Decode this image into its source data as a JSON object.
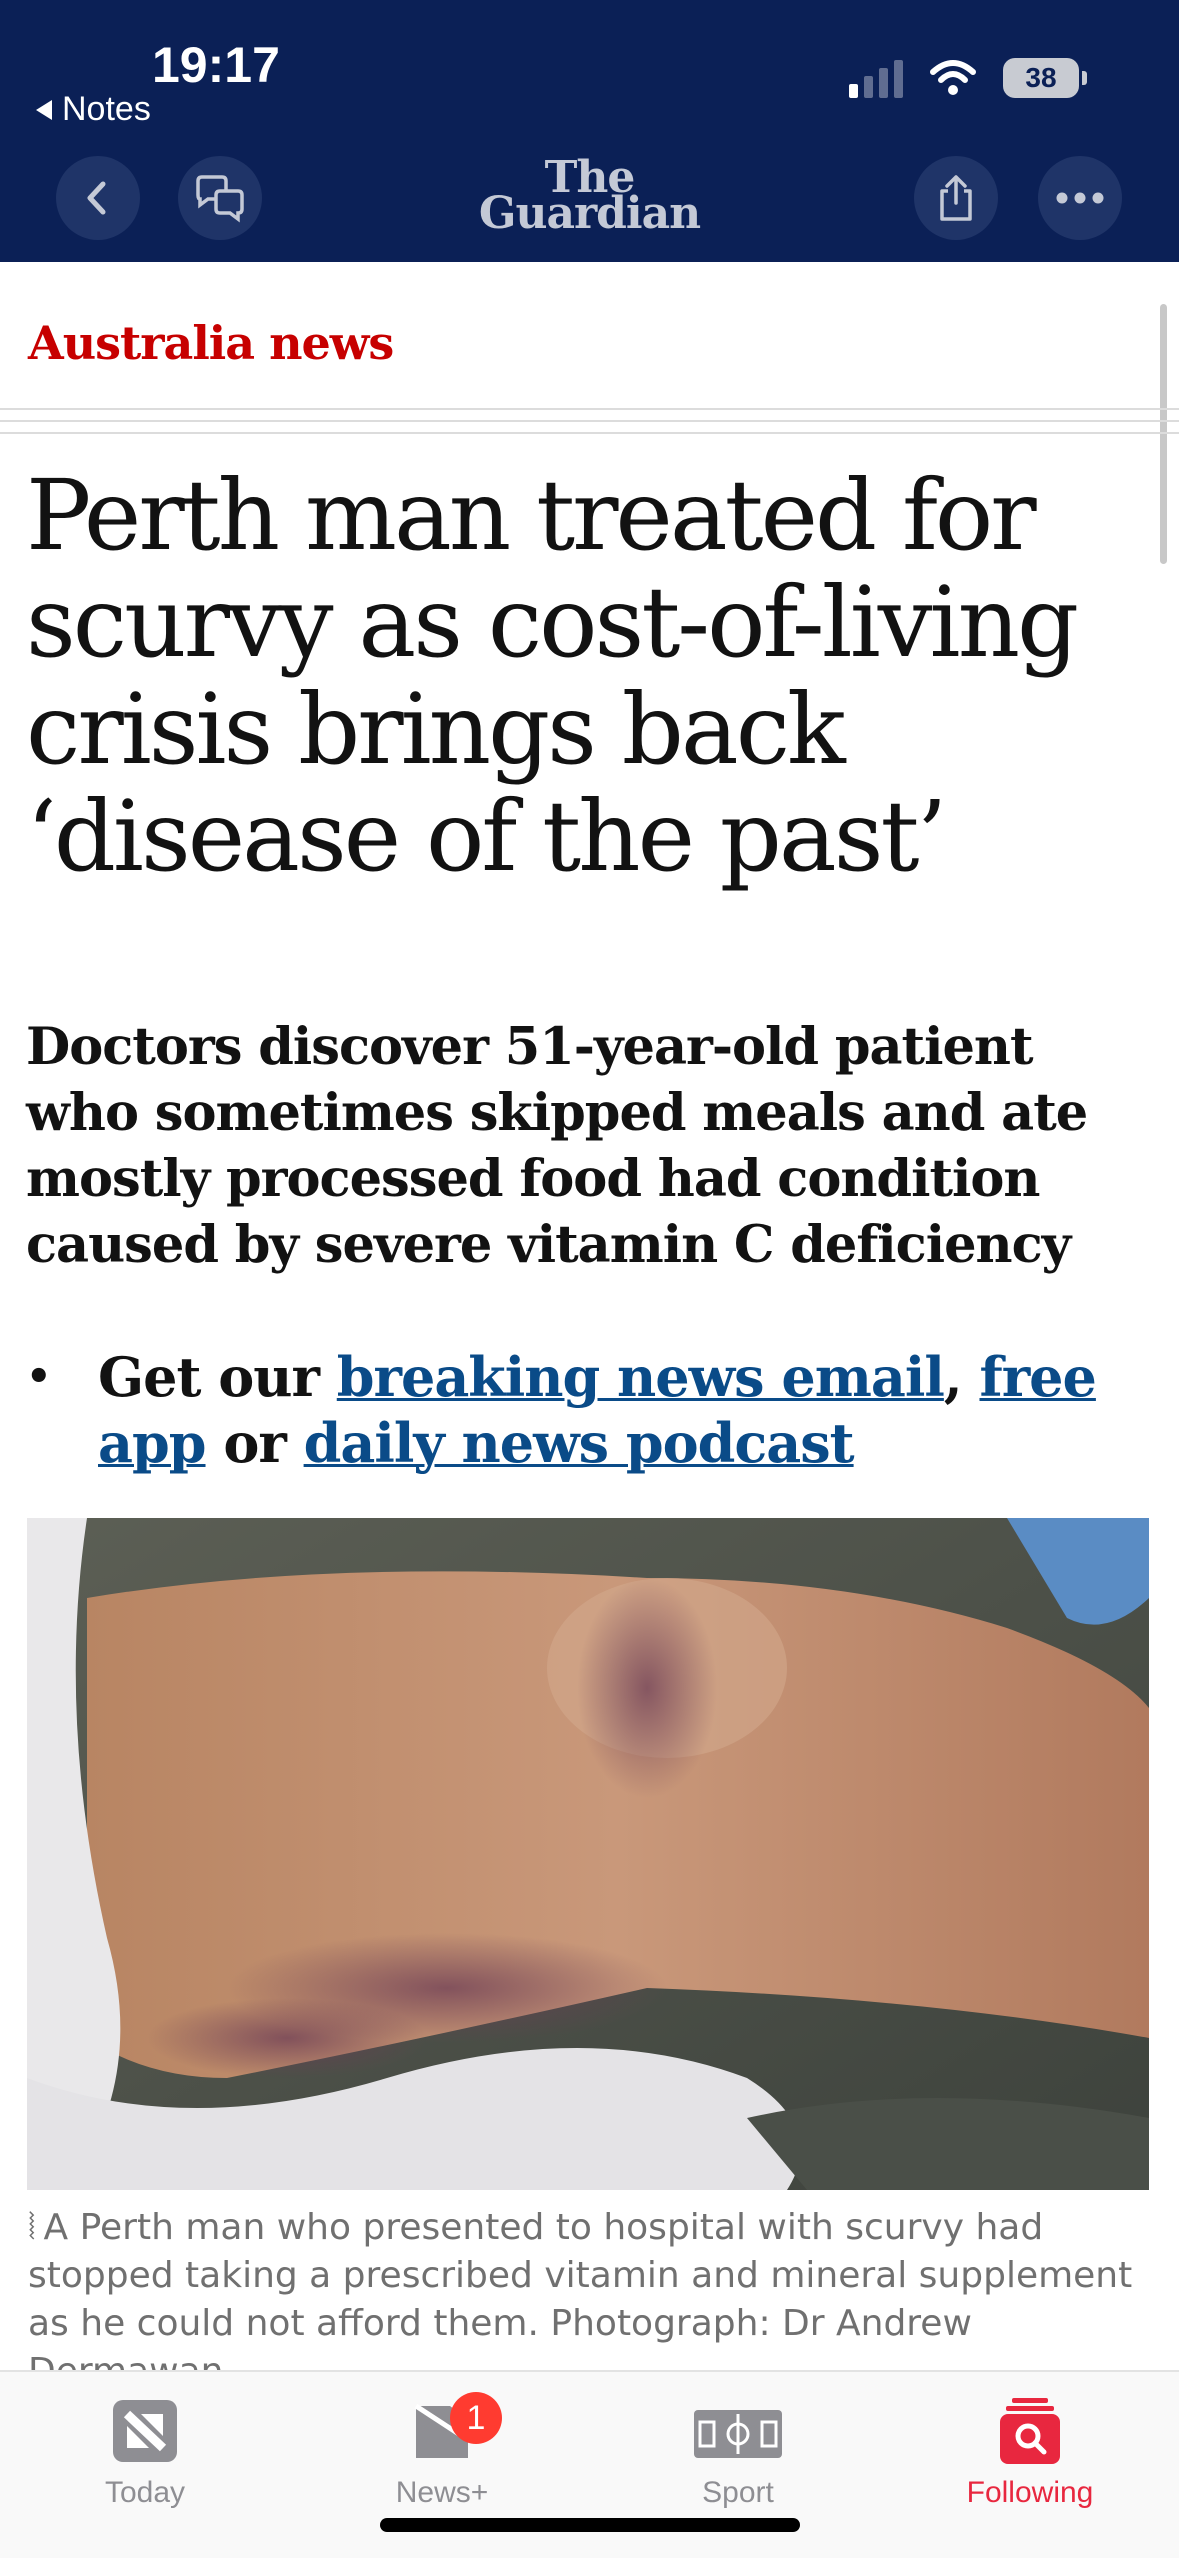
{
  "status_bar": {
    "time": "19:17",
    "back_app": "Notes",
    "battery": "38"
  },
  "header": {
    "brand_line1": "The",
    "brand_line2": "Guardian"
  },
  "article": {
    "section": "Australia news",
    "headline": "Perth man treated for scurvy as cost-of-living crisis brings back ‘disease of the past’",
    "standfirst": "Doctors discover 51-year-old patient who sometimes skipped meals and ate mostly processed food had condition caused by severe vitamin C deficiency",
    "bullet": {
      "prefix": "Get our ",
      "link1": "breaking news email",
      "sep1": ", ",
      "link2": "free app",
      "sep2": " or ",
      "link3": "daily news podcast"
    },
    "image_alt": "Leg with scurvy rash",
    "caption": "A Perth man who presented to hospital with scurvy had stopped taking a prescribed vitamin and mineral supplement as he could not afford them. Photograph: Dr Andrew Dermawan."
  },
  "tabbar": {
    "tabs": [
      {
        "label": "Today",
        "icon": "news-logo-icon"
      },
      {
        "label": "News+",
        "icon": "news-plus-icon",
        "badge": "1"
      },
      {
        "label": "Sport",
        "icon": "sport-field-icon"
      },
      {
        "label": "Following",
        "icon": "following-search-icon"
      }
    ],
    "active_color": "#e8273f"
  },
  "colors": {
    "header_bg": "#0b2056",
    "section_red": "#c70000",
    "link_blue": "#0a4b88"
  }
}
